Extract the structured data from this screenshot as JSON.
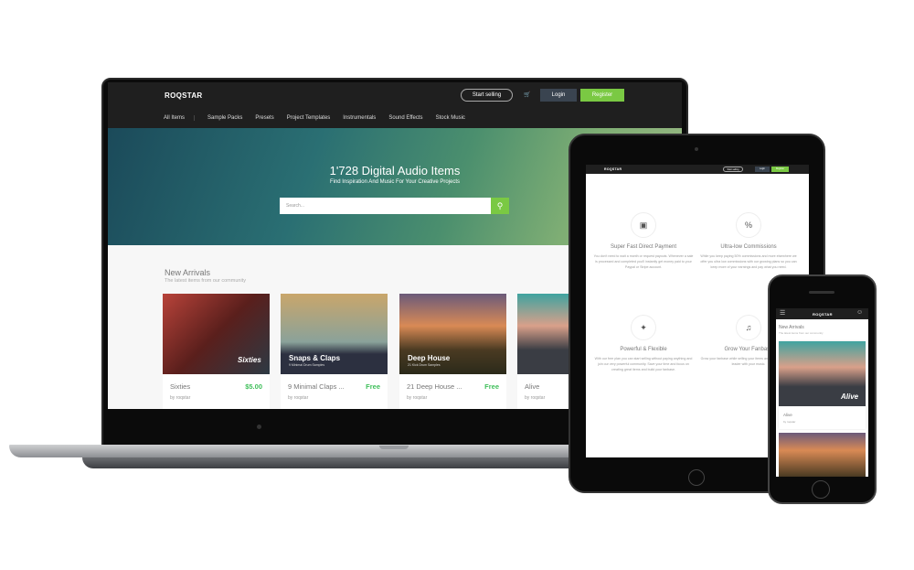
{
  "brand": "ROQSTAR",
  "header": {
    "start_selling": "Start selling",
    "cart_icon": "cart-icon",
    "login": "Login",
    "register": "Register"
  },
  "nav": [
    "All Items",
    "Sample Packs",
    "Presets",
    "Project Templates",
    "Instrumentals",
    "Sound Effects",
    "Stock Music"
  ],
  "hero": {
    "title": "1'728 Digital Audio Items",
    "subtitle": "Find Inspiration And Music For Your Creative Projects",
    "search_placeholder": "Search..."
  },
  "new_arrivals": {
    "title": "New Arrivals",
    "subtitle": "The latest items from our community"
  },
  "cards": [
    {
      "name": "Sixties",
      "price": "$5.00",
      "by": "by roqstar",
      "overlay": "Sixties",
      "overlay_sub": ""
    },
    {
      "name": "9 Minimal Claps ...",
      "price": "Free",
      "by": "by roqstar",
      "overlay": "Snaps & Claps",
      "overlay_sub": "9 Minimal Drum Samples"
    },
    {
      "name": "21 Deep House ...",
      "price": "Free",
      "by": "by roqstar",
      "overlay": "Deep House",
      "overlay_sub": "21 Kick Drum Samples"
    },
    {
      "name": "Alive",
      "price": "",
      "by": "by roqstar",
      "overlay": "",
      "overlay_sub": ""
    }
  ],
  "features": [
    {
      "icon": "wallet-icon",
      "title": "Super Fast Direct Payment",
      "desc": "You don't need to wait a month or request payouts. Whenever a sale is processed and completed you'll instantly get money paid to your Paypal or Stripe account."
    },
    {
      "icon": "percent-icon",
      "title": "Ultra-low Commissions",
      "desc": "While you keep paying 50% commissions and more elsewhere we offer you ultra low commissions with our growing plans so you can keep more of your earnings and pay what you need."
    },
    {
      "icon": "rocket-icon",
      "title": "Powerful & Flexible",
      "desc": "With our free plan you can start selling without paying anything and join our very powerful community. Save your time and focus on creating great items and build your fanbase."
    },
    {
      "icon": "music-icon",
      "title": "Grow Your Fanbase",
      "desc": "Grow your fanbase while selling your items and become a wanted leader with your music."
    }
  ],
  "phone": {
    "card_name": "Alive",
    "card_by": "by roqstar",
    "overlay": "Alive"
  }
}
